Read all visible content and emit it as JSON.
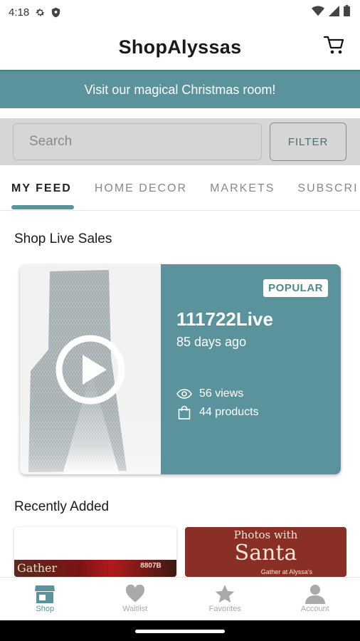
{
  "status_bar": {
    "time": "4:18",
    "icons_left": [
      "gear-icon",
      "shield-icon"
    ],
    "icons_right": [
      "wifi-icon",
      "signal-icon",
      "battery-icon"
    ]
  },
  "header": {
    "title": "ShopAlyssas",
    "cart_icon": "cart-icon"
  },
  "promo_banner": {
    "text": "Visit our magical Christmas room!"
  },
  "search": {
    "placeholder": "Search",
    "filter_label": "FILTER"
  },
  "tabs": [
    {
      "label": "MY FEED",
      "active": true
    },
    {
      "label": "HOME DECOR",
      "active": false
    },
    {
      "label": "MARKETS",
      "active": false
    },
    {
      "label": "SUBSCRI",
      "active": false
    }
  ],
  "live_section": {
    "title": "Shop Live Sales",
    "card": {
      "badge": "POPULAR",
      "title": "111722Live",
      "date": "85 days ago",
      "views": "56 views",
      "products": "44 products"
    }
  },
  "recent_section": {
    "title": "Recently Added",
    "card1": {
      "strip_text": "Gather",
      "badge_text": "8807B"
    },
    "card2": {
      "line1": "Photos with",
      "line2": "Santa",
      "line3": "Gather at Alyssa's"
    }
  },
  "bottom_nav": [
    {
      "label": "Shop",
      "icon": "store-icon",
      "active": true
    },
    {
      "label": "Waitlist",
      "icon": "heart-icon",
      "active": false
    },
    {
      "label": "Favorites",
      "icon": "star-icon",
      "active": false
    },
    {
      "label": "Account",
      "icon": "person-icon",
      "active": false
    }
  ],
  "colors": {
    "accent": "#5a939c",
    "search_bg": "#d6d6d6",
    "nav_inactive": "#a9a9a9",
    "santa_card_bg": "#8a2f26"
  }
}
